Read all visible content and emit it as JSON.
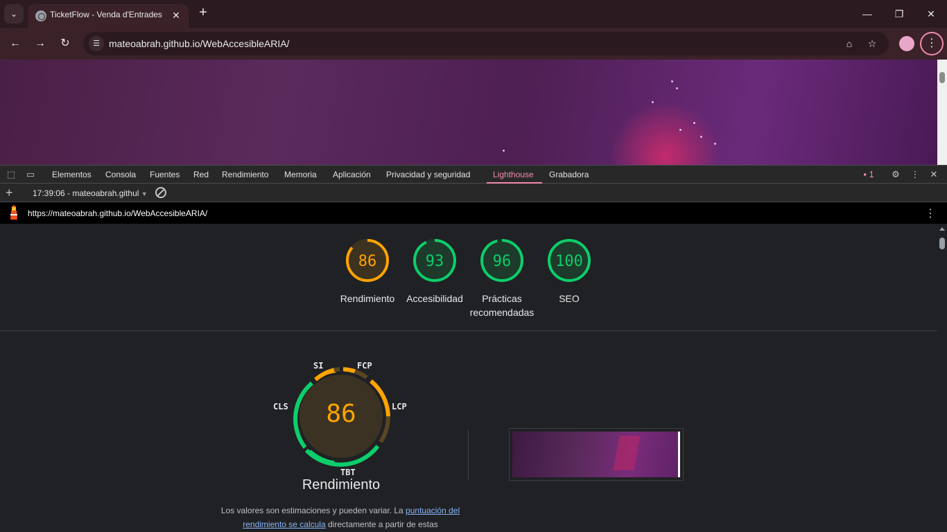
{
  "browser": {
    "tab_title": "TicketFlow - Venda d'Entrades",
    "tab_close": "✕",
    "new_tab": "+",
    "minimize": "—",
    "restore": "❐",
    "close": "✕",
    "url": "mateoabrah.github.io/WebAccesibleARIA/",
    "back": "←",
    "forward": "→",
    "reload": "↻",
    "menu": "⋮",
    "tab_search": "⌄"
  },
  "devtools": {
    "tabs": [
      "Elementos",
      "Consola",
      "Fuentes",
      "Red",
      "Rendimiento",
      "Memoria",
      "Aplicación",
      "Privacidad y seguridad",
      "Lighthouse",
      "Grabadora"
    ],
    "active_tab": "Lighthouse",
    "issues_count": "1",
    "close": "✕",
    "more": "⋮"
  },
  "lighthouse": {
    "report_label": "17:39:06 - mateoabrah.githul",
    "new_report": "+",
    "page_url": "https://mateoabrah.github.io/WebAccesibleARIA/",
    "more": "⋮",
    "scores": [
      {
        "value": "86",
        "label": "Rendimiento",
        "color": "#ffa400"
      },
      {
        "value": "93",
        "label": "Accesibilidad",
        "color": "#0cce6b"
      },
      {
        "value": "96",
        "label": "Prácticas recomendadas",
        "color": "#0cce6b"
      },
      {
        "value": "100",
        "label": "SEO",
        "color": "#0cce6b"
      }
    ],
    "performance": {
      "score": "86",
      "title": "Rendimiento",
      "metrics": {
        "si": "SI",
        "fcp": "FCP",
        "lcp": "LCP",
        "tbt": "TBT",
        "cls": "CLS"
      },
      "note_1": "Los valores son estimaciones y pueden variar. La",
      "note_link": "puntuación del rendimiento se calcula",
      "note_2": "directamente a partir de estas"
    }
  }
}
